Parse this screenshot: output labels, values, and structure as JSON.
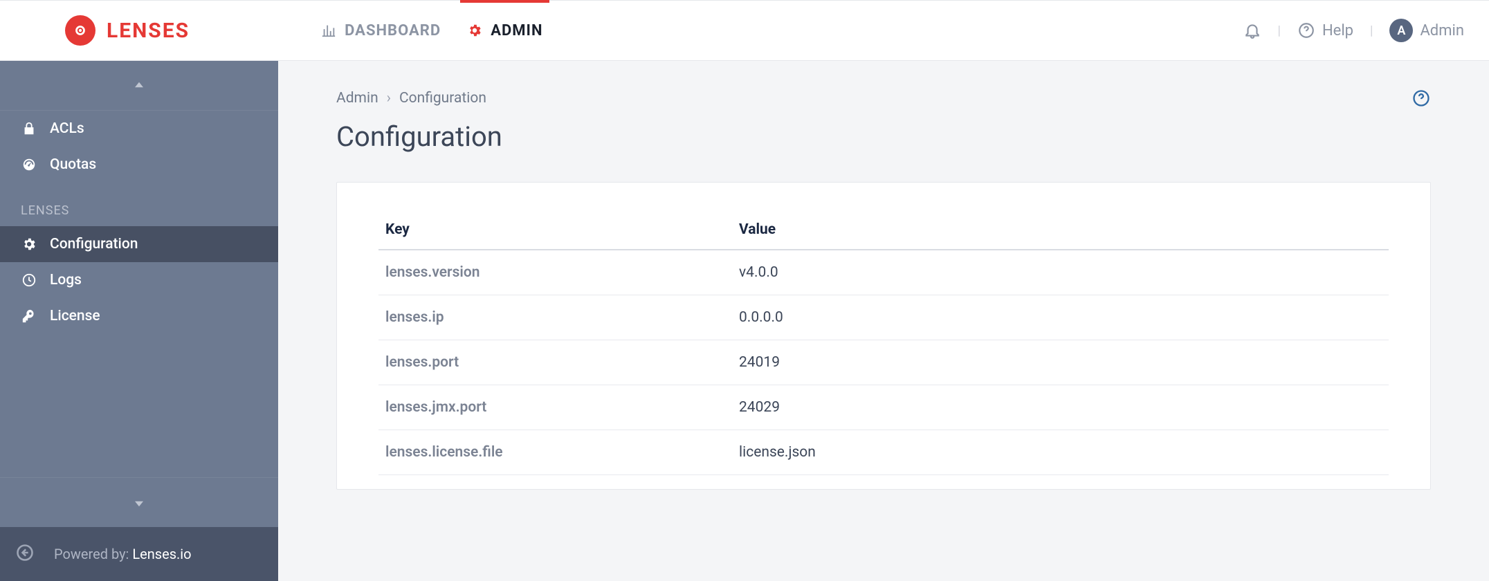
{
  "brand": {
    "name": "LENSES"
  },
  "topnav": {
    "dashboard": "DASHBOARD",
    "admin": "ADMIN"
  },
  "topright": {
    "help": "Help",
    "user_initial": "A",
    "user_name": "Admin"
  },
  "sidebar": {
    "top_items": [
      {
        "label": "ACLs",
        "icon": "lock-icon"
      },
      {
        "label": "Quotas",
        "icon": "gauge-icon"
      }
    ],
    "section_title": "LENSES",
    "lenses_items": [
      {
        "label": "Configuration",
        "icon": "gear-icon",
        "active": true
      },
      {
        "label": "Logs",
        "icon": "clock-icon"
      },
      {
        "label": "License",
        "icon": "key-icon"
      }
    ],
    "footer_prefix": "Powered by: ",
    "footer_link": "Lenses.io"
  },
  "breadcrumb": {
    "admin": "Admin",
    "current": "Configuration"
  },
  "page_title": "Configuration",
  "table": {
    "headers": {
      "key": "Key",
      "value": "Value"
    },
    "rows": [
      {
        "key": "lenses.version",
        "value": "v4.0.0"
      },
      {
        "key": "lenses.ip",
        "value": "0.0.0.0"
      },
      {
        "key": "lenses.port",
        "value": "24019"
      },
      {
        "key": "lenses.jmx.port",
        "value": "24029"
      },
      {
        "key": "lenses.license.file",
        "value": "license.json"
      }
    ]
  }
}
